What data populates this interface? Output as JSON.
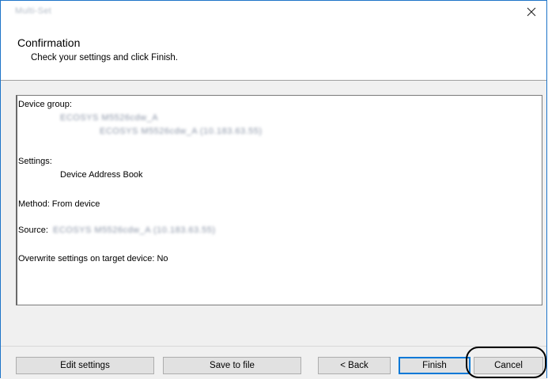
{
  "window": {
    "title": "Multi-Set"
  },
  "header": {
    "title": "Confirmation",
    "subtitle": "Check your settings and click Finish."
  },
  "summary": {
    "device_group_label": "Device group:",
    "device_group_line1": "ECOSYS M5526cdw_A",
    "device_group_line2": "ECOSYS M5526cdw_A (10.183.63.55)",
    "settings_label": "Settings:",
    "settings_value": "Device Address Book",
    "method_text": "Method: From device",
    "source_label": "Source:",
    "source_value": "ECOSYS M5526cdw_A (10.183.63.55)",
    "overwrite_text": "Overwrite settings on target device: No"
  },
  "buttons": {
    "edit_settings": "Edit settings",
    "save_to_file": "Save to file",
    "back": "< Back",
    "finish": "Finish",
    "cancel": "Cancel"
  }
}
